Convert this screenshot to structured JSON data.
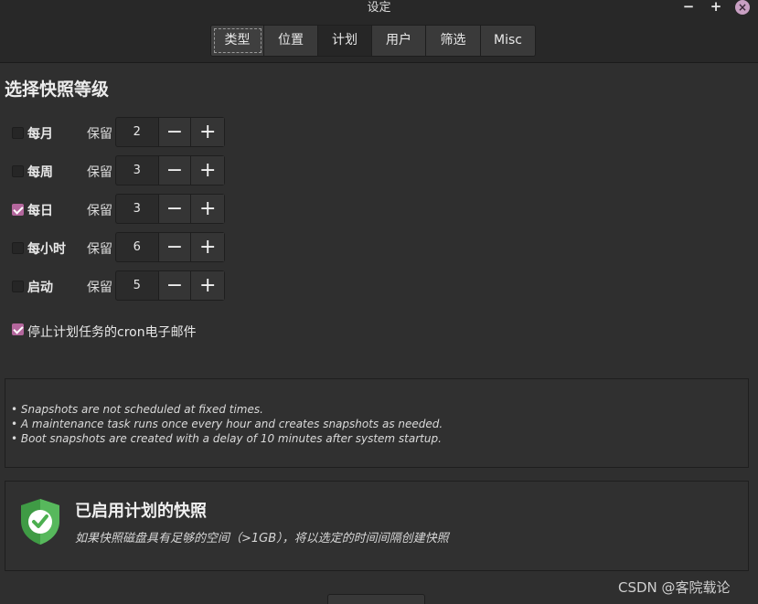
{
  "window": {
    "title": "设定",
    "minimize": "−",
    "maximize": "+",
    "close": "×"
  },
  "tabs": [
    {
      "label": "类型",
      "state": "focused"
    },
    {
      "label": "位置",
      "state": "normal"
    },
    {
      "label": "计划",
      "state": "active"
    },
    {
      "label": "用户",
      "state": "normal"
    },
    {
      "label": "筛选",
      "state": "normal"
    },
    {
      "label": "Misc",
      "state": "normal"
    }
  ],
  "schedule": {
    "heading": "选择快照等级",
    "keep_label": "保留",
    "decrement": "−",
    "increment": "+",
    "rows": [
      {
        "label": "每月",
        "checked": false,
        "keep": "2"
      },
      {
        "label": "每周",
        "checked": false,
        "keep": "3"
      },
      {
        "label": "每日",
        "checked": true,
        "keep": "3"
      },
      {
        "label": "每小时",
        "checked": false,
        "keep": "6"
      },
      {
        "label": "启动",
        "checked": false,
        "keep": "5"
      }
    ],
    "cron_email": {
      "label": "停止计划任务的cron电子邮件",
      "checked": true
    }
  },
  "info": {
    "lines": [
      "• Snapshots are not scheduled at fixed times.",
      "• A maintenance task runs once every hour and creates snapshots as needed.",
      "• Boot snapshots are created with a delay of 10 minutes after system startup."
    ]
  },
  "status": {
    "title": "已启用计划的快照",
    "subtitle": "如果快照磁盘具有足够的空间（>1GB），将以选定的时间间隔创建快照",
    "icon": "shield-check-icon",
    "icon_color": "#4caf50"
  },
  "watermark": "CSDN @客院载论",
  "colors": {
    "accent": "#b4679d",
    "background": "#2f2f2f",
    "header": "#282828"
  }
}
